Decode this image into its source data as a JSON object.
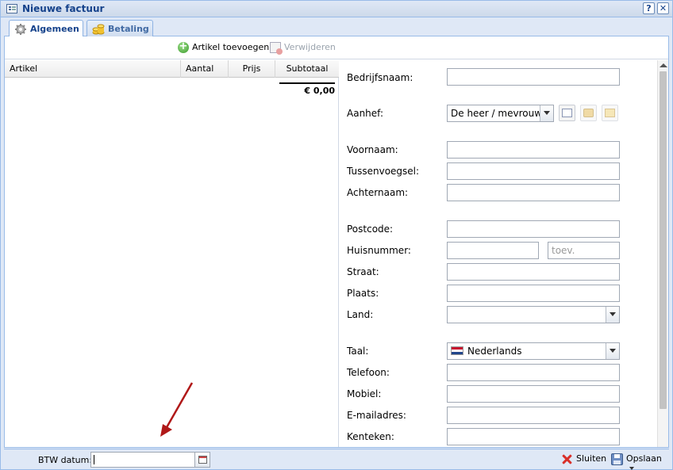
{
  "window": {
    "title": "Nieuwe factuur",
    "tools": {
      "help": "?",
      "close": "✕"
    }
  },
  "tabs": [
    {
      "label": "Algemeen",
      "icon": "gear-icon",
      "active": true
    },
    {
      "label": "Betaling",
      "icon": "coins-icon",
      "active": false
    }
  ],
  "toolbar": {
    "add_label": "Artikel toevoegen",
    "remove_label": "Verwijderen"
  },
  "grid": {
    "columns": [
      "Artikel",
      "Aantal",
      "Prijs",
      "Subtotaal"
    ],
    "total": "€ 0,00"
  },
  "form": {
    "bedrijfsnaam_label": "Bedrijfsnaam:",
    "aanhef_label": "Aanhef:",
    "aanhef_value": "De heer / mevrouw",
    "voornaam_label": "Voornaam:",
    "tussenvoegsel_label": "Tussenvoegsel:",
    "achternaam_label": "Achternaam:",
    "postcode_label": "Postcode:",
    "huisnummer_label": "Huisnummer:",
    "toev_placeholder": "toev.",
    "straat_label": "Straat:",
    "plaats_label": "Plaats:",
    "land_label": "Land:",
    "taal_label": "Taal:",
    "taal_value": "Nederlands",
    "telefoon_label": "Telefoon:",
    "mobiel_label": "Mobiel:",
    "email_label": "E-mailadres:",
    "kenteken_label": "Kenteken:"
  },
  "footer": {
    "btw_label": "BTW datum:",
    "close_label": "Sluiten",
    "save_label": "Opslaan"
  },
  "colors": {
    "frame": "#dfe8f6",
    "border": "#99bbe8",
    "title_text": "#15428b",
    "annotation_arrow": "#b01818"
  }
}
